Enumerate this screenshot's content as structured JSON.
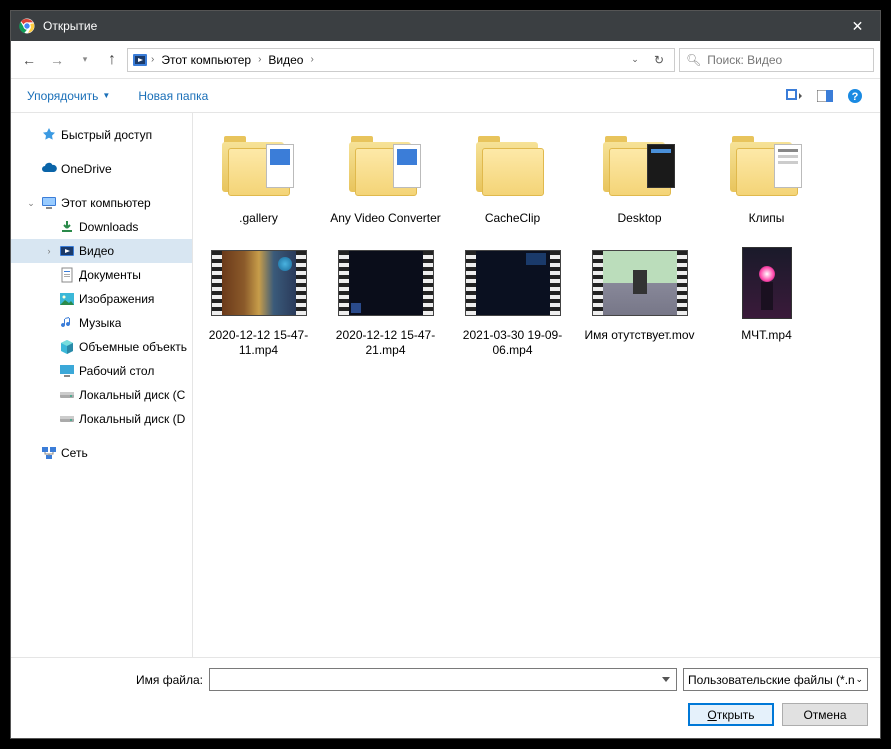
{
  "window": {
    "title": "Открытие"
  },
  "breadcrumbs": {
    "root": "Этот компьютер",
    "folder": "Видео"
  },
  "search": {
    "placeholder": "Поиск: Видео"
  },
  "toolbar": {
    "organize": "Упорядочить",
    "new_folder": "Новая папка"
  },
  "sidebar": {
    "quick_access": "Быстрый доступ",
    "onedrive": "OneDrive",
    "this_pc": "Этот компьютер",
    "downloads": "Downloads",
    "video": "Видео",
    "documents": "Документы",
    "pictures": "Изображения",
    "music": "Музыка",
    "volumes": "Объемные объекть",
    "desktop": "Рабочий стол",
    "disk_c": "Локальный диск (C",
    "disk_d": "Локальный диск (D",
    "network": "Сеть"
  },
  "files": {
    "f0": ".gallery",
    "f1": "Any Video Converter",
    "f2": "CacheClip",
    "f3": "Desktop",
    "f4": "Клипы",
    "f5": "2020-12-12 15-47-11.mp4",
    "f6": "2020-12-12 15-47-21.mp4",
    "f7": "2021-03-30 19-09-06.mp4",
    "f8": "Имя отутствует.mov",
    "f9": "МЧТ.mp4"
  },
  "footer": {
    "filename_label": "Имя файла:",
    "filename_value": "",
    "filetype": "Пользовательские файлы (*.n",
    "open": "ткрыть",
    "open_accel": "О",
    "cancel": "Отмена"
  }
}
